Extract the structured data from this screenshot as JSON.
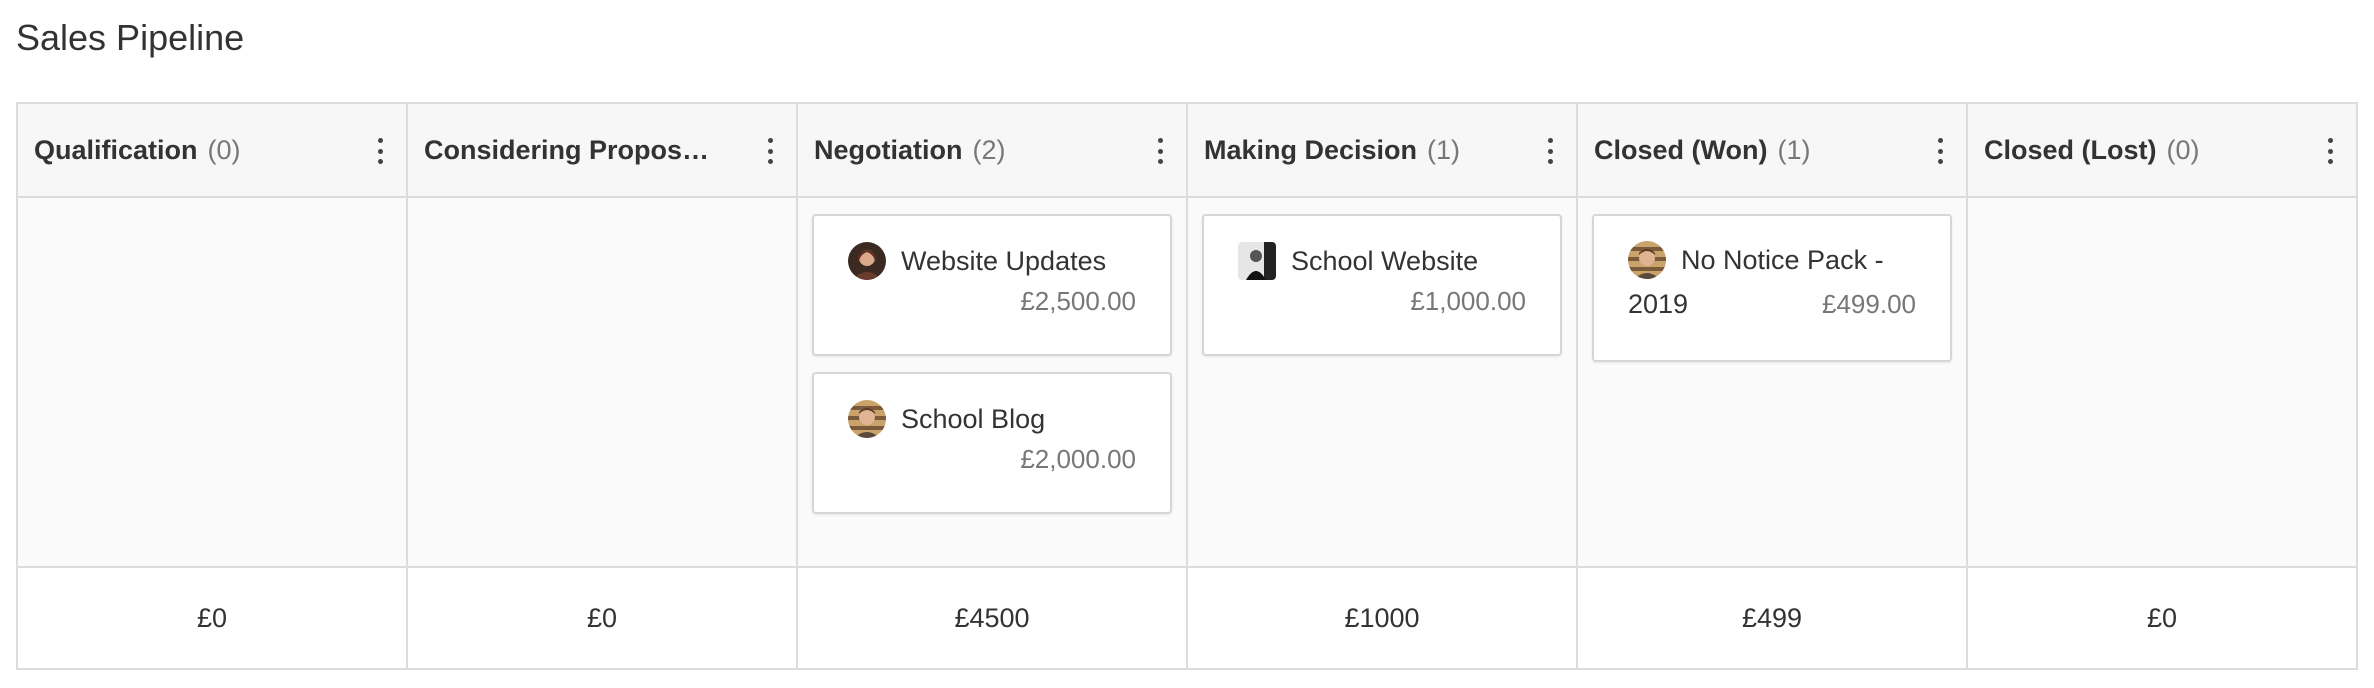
{
  "page": {
    "title": "Sales Pipeline"
  },
  "columns": [
    {
      "title": "Qualification",
      "count": "(0)",
      "total": "£0",
      "cards": []
    },
    {
      "title": "Considering Proposal ...",
      "count": "",
      "total": "£0",
      "cards": []
    },
    {
      "title": "Negotiation",
      "count": "(2)",
      "total": "£4500",
      "cards": [
        {
          "title": "Website Updates",
          "value": "£2,500.00",
          "avatar": "person-woman-avatar"
        },
        {
          "title": "School Blog",
          "value": "£2,000.00",
          "avatar": "person-man-avatar"
        }
      ]
    },
    {
      "title": "Making Decision",
      "count": "(1)",
      "total": "£1000",
      "cards": [
        {
          "title": "School Website",
          "value": "£1,000.00",
          "avatar": "person-mono-avatar"
        }
      ]
    },
    {
      "title": "Closed (Won)",
      "count": "(1)",
      "total": "£499",
      "cards": [
        {
          "title_line1": "No Notice Pack -",
          "title_line2": "2019",
          "value": "£499.00",
          "avatar": "person-man-avatar"
        }
      ]
    },
    {
      "title": "Closed (Lost)",
      "count": "(0)",
      "total": "£0",
      "cards": []
    }
  ],
  "colors": {
    "border": "#dcdcdc",
    "header_bg": "#f7f7f7",
    "body_bg": "#fafafa",
    "muted_text": "#777777"
  }
}
